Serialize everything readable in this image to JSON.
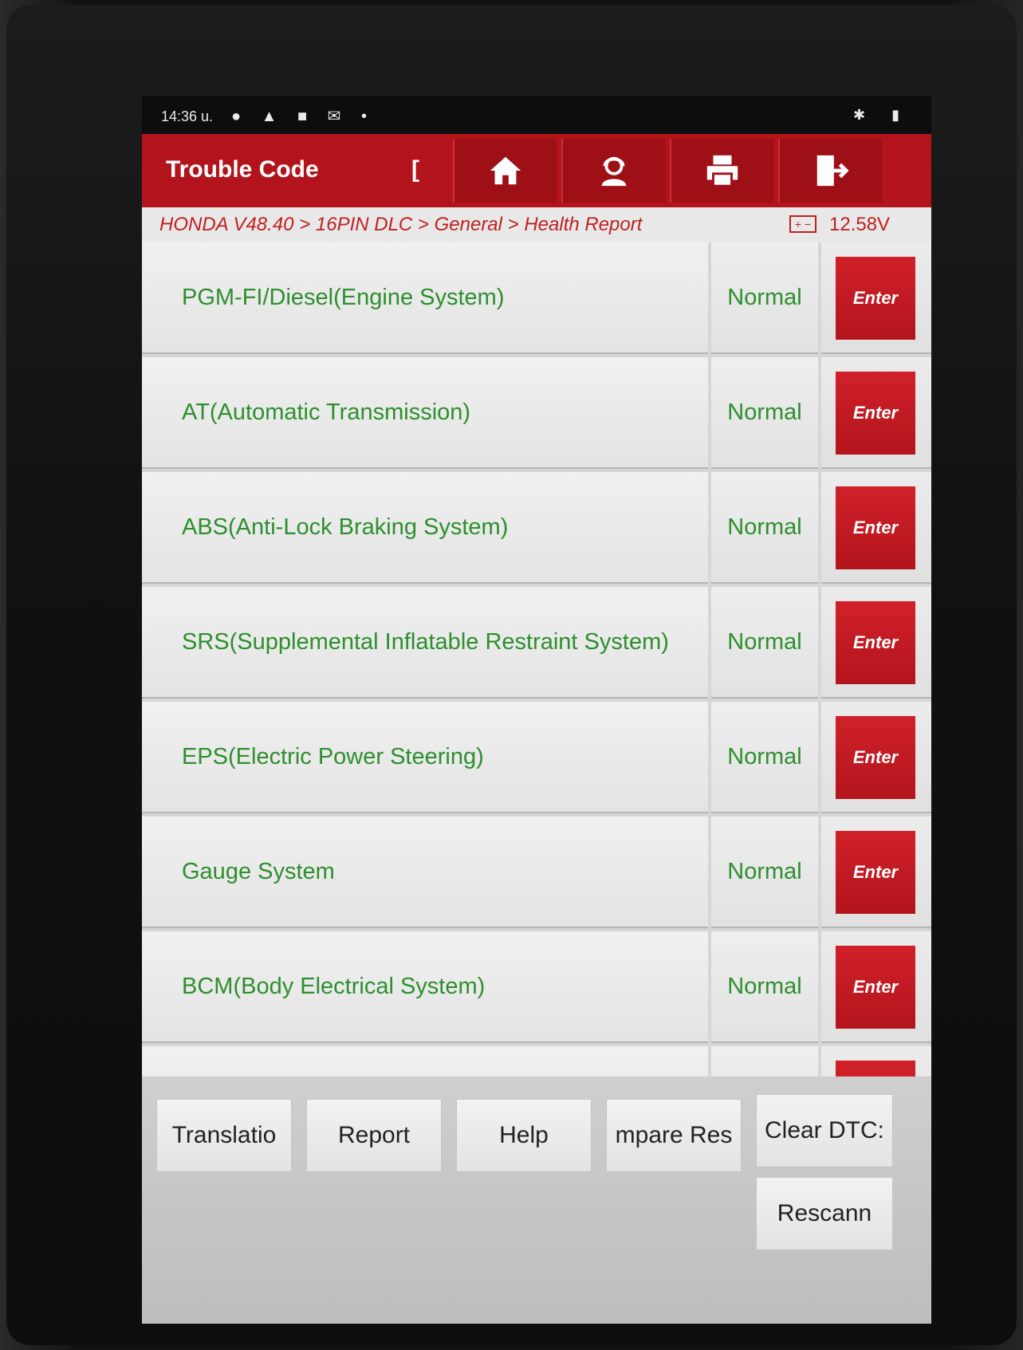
{
  "statusbar": {
    "time": "14:36 u."
  },
  "header": {
    "title": "Trouble Code",
    "title_fragment": "[",
    "buttons": [
      {
        "icon": "home-icon"
      },
      {
        "icon": "support-icon"
      },
      {
        "icon": "printer-icon"
      },
      {
        "icon": "exit-icon"
      }
    ]
  },
  "breadcrumb": {
    "path": "HONDA V48.40 > 16PIN DLC > General > Health Report",
    "voltage": "12.58V"
  },
  "systems": [
    {
      "name": "PGM-FI/Diesel(Engine System)",
      "status": "Normal",
      "action": "Enter"
    },
    {
      "name": "AT(Automatic Transmission)",
      "status": "Normal",
      "action": "Enter"
    },
    {
      "name": "ABS(Anti-Lock Braking System)",
      "status": "Normal",
      "action": "Enter"
    },
    {
      "name": "SRS(Supplemental Inflatable Restraint System)",
      "status": "Normal",
      "action": "Enter"
    },
    {
      "name": "EPS(Electric Power Steering)",
      "status": "Normal",
      "action": "Enter"
    },
    {
      "name": "Gauge System",
      "status": "Normal",
      "action": "Enter"
    },
    {
      "name": "BCM(Body Electrical System)",
      "status": "Normal",
      "action": "Enter"
    }
  ],
  "toolbar": {
    "translation": "Translatio",
    "report": "Report",
    "help": "Help",
    "compare": "mpare Res",
    "clear": "Clear DTC:",
    "rescan": "Rescann"
  }
}
